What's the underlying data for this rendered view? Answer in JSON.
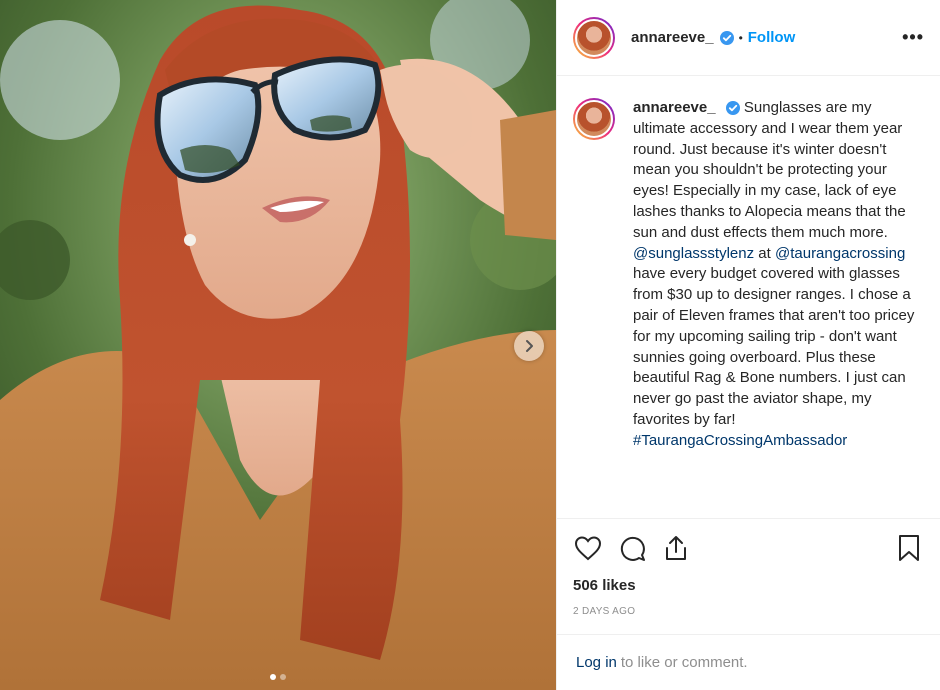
{
  "header": {
    "username": "annareeve_",
    "separator": "•",
    "follow_label": "Follow",
    "more_label": "•••",
    "avatar_icon": "profile-avatar",
    "verified_icon": "verified-badge-icon"
  },
  "caption": {
    "username": "annareeve_",
    "text_1": "Sunglasses are my ultimate accessory and I wear them year round. Just because it's winter doesn't mean you shouldn't be protecting your eyes! Especially in my case, lack of eye lashes thanks to Alopecia means that the sun and dust effects them much more.",
    "mention_1": "@sunglassstylenz",
    "text_2": " at ",
    "mention_2": "@taurangacrossing",
    "text_3": " have every budget covered with glasses from $30 up to designer ranges. I chose a pair of Eleven frames that aren't too pricey for my upcoming sailing trip - don't want sunnies going overboard. Plus these beautiful Rag & Bone numbers. I just can never go past the aviator shape, my favorites by far!",
    "hashtag": "#TaurangaCrossingAmbassador"
  },
  "actions": {
    "like_icon": "heart-icon",
    "comment_icon": "comment-icon",
    "share_icon": "share-icon",
    "save_icon": "bookmark-icon"
  },
  "likes_text": "506 likes",
  "timestamp": "2 DAYS AGO",
  "login_bar": {
    "login_label": "Log in",
    "rest_text": "to like or comment."
  },
  "carousel": {
    "next_icon": "chevron-right-icon",
    "slide_count": 2,
    "active_index": 0
  },
  "colors": {
    "accent": "#0095f6",
    "link": "#00376b",
    "verified": "#3897f0",
    "muted": "#8e8e8e"
  }
}
